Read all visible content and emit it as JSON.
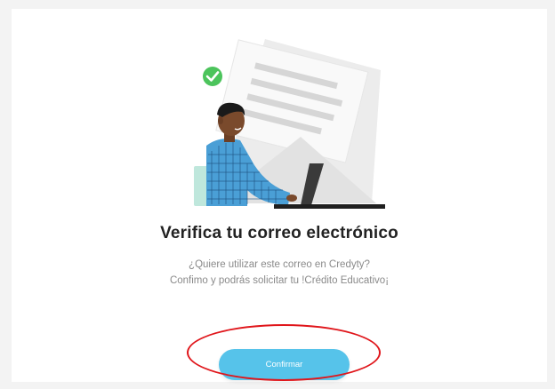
{
  "dialog": {
    "title": "Verifica tu correo electrónico",
    "subtitle_line1": "¿Quiere utilizar este correo en Credyty?",
    "subtitle_line2": "Confimo y podrás solicitar tu !Crédito Educativo¡",
    "confirm_label": "Confirmar"
  },
  "colors": {
    "accent": "#56c3ea",
    "check": "#4cc45c",
    "highlight": "#e0161b"
  },
  "icons": {
    "check": "check-icon",
    "illustration": "email-verification-illustration"
  }
}
